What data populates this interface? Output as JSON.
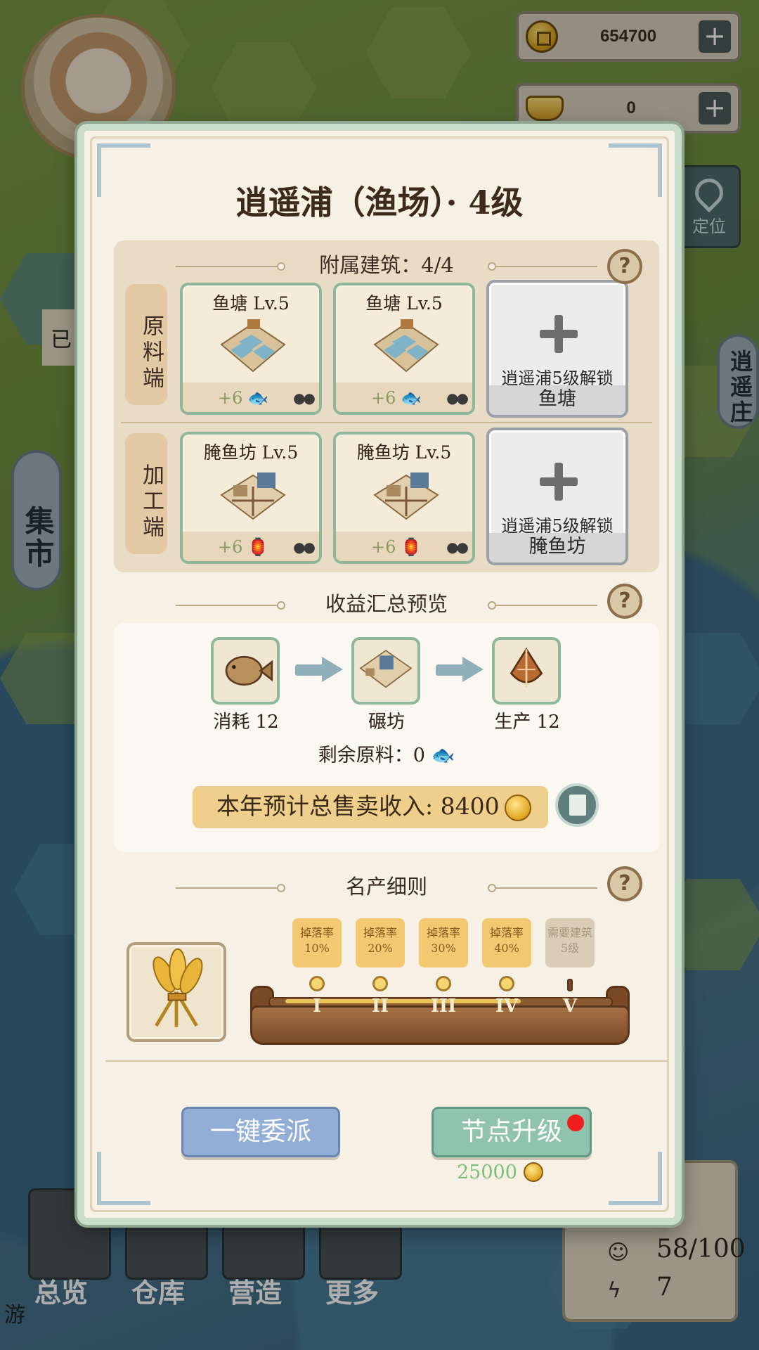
{
  "hud": {
    "coins": "654700",
    "ingots": "0",
    "locate_label": "定位",
    "left_banner": "集市",
    "right_banner": "逍遥庄",
    "left_stub": "已"
  },
  "nav": {
    "items": [
      {
        "label": "总览",
        "icon": "scroll-telescope-icon"
      },
      {
        "label": "仓库",
        "icon": "warehouse-icon"
      },
      {
        "label": "营造",
        "icon": "build-icon"
      },
      {
        "label": "更多",
        "icon": "more-icon"
      }
    ],
    "population": "58/100",
    "energy": "7",
    "partial_text": "游"
  },
  "modal": {
    "title": "逍遥浦（渔场）· 4级",
    "attached_header": "附属建筑：4/4",
    "rows": [
      {
        "tag": "原料端",
        "buildings": [
          {
            "name": "鱼塘 Lv.5",
            "yield": "+6",
            "yield_icon": "fish-icon"
          },
          {
            "name": "鱼塘 Lv.5",
            "yield": "+6",
            "yield_icon": "fish-icon"
          }
        ],
        "locked": {
          "requirement": "逍遥浦5级解锁",
          "target": "鱼塘"
        }
      },
      {
        "tag": "加工端",
        "buildings": [
          {
            "name": "腌鱼坊 Lv.5",
            "yield": "+6",
            "yield_icon": "salted-fish-icon"
          },
          {
            "name": "腌鱼坊 Lv.5",
            "yield": "+6",
            "yield_icon": "salted-fish-icon"
          }
        ],
        "locked": {
          "requirement": "逍遥浦5级解锁",
          "target": "腌鱼坊"
        }
      }
    ],
    "income_header": "收益汇总预览",
    "flow": {
      "consume": "消耗 12",
      "workshop": "碾坊",
      "produce": "生产 12"
    },
    "remaining": "剩余原料：0",
    "revenue": "本年预计总售卖收入: 8400",
    "specialty_header": "名产细则",
    "tiers": [
      {
        "line1": "掉落率",
        "line2": "10%",
        "roman": "I",
        "locked": false
      },
      {
        "line1": "掉落率",
        "line2": "20%",
        "roman": "II",
        "locked": false
      },
      {
        "line1": "掉落率",
        "line2": "30%",
        "roman": "III",
        "locked": false
      },
      {
        "line1": "掉落率",
        "line2": "40%",
        "roman": "IV",
        "locked": false
      },
      {
        "line1": "需要建筑",
        "line2": "5级",
        "roman": "V",
        "locked": true
      }
    ],
    "dispatch_button": "一键委派",
    "upgrade_button": "节点升级",
    "upgrade_cost": "25000"
  },
  "colors": {
    "accent_green": "#8fc3ae",
    "accent_blue": "#93aed6",
    "gold": "#efcf8c",
    "notification": "#f21d1d"
  }
}
